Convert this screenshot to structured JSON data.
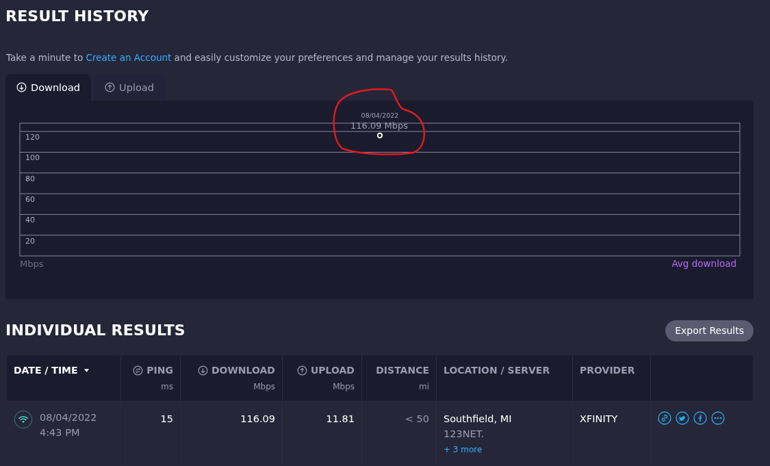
{
  "history": {
    "title": "RESULT HISTORY",
    "intro": {
      "before": "Take a minute to ",
      "link": "Create an Account",
      "after": " and easily customize your preferences and manage your results history."
    },
    "tabs": [
      {
        "label": "Download",
        "kind": "download",
        "selected": true
      },
      {
        "label": "Upload",
        "kind": "upload",
        "selected": false
      }
    ],
    "tooltip_value": "116.09 Mbps",
    "unit_label": "Mbps",
    "chart_data": {
      "type": "line",
      "categories": [
        "08/04/2022"
      ],
      "series": [
        {
          "name": "Avg download",
          "color": "#ffffff",
          "marker": true,
          "values": [
            116.09
          ]
        }
      ],
      "ylim": [
        0,
        128
      ],
      "yticks": [
        20,
        40,
        60,
        80,
        100,
        120
      ],
      "grid": true
    }
  },
  "results": {
    "title": "INDIVIDUAL RESULTS",
    "export_button": "Export Results",
    "columns": [
      {
        "label": "DATE / TIME",
        "kind": "text",
        "sorted": true
      },
      {
        "label": "PING",
        "unit": "ms",
        "kind": "ping",
        "sorted": false
      },
      {
        "label": "DOWNLOAD",
        "unit": "Mbps",
        "kind": "download",
        "sorted": false
      },
      {
        "label": "UPLOAD",
        "unit": "Mbps",
        "kind": "upload",
        "sorted": false
      },
      {
        "label": "DISTANCE",
        "unit": "mi",
        "kind": "text",
        "sorted": false
      },
      {
        "label": "LOCATION / SERVER",
        "kind": "text",
        "sorted": false
      },
      {
        "label": "PROVIDER",
        "kind": "text",
        "sorted": false
      }
    ],
    "rows": [
      {
        "date": "08/04/2022",
        "time": "4:43 PM",
        "ping": "15",
        "download": "116.09",
        "upload": "11.81",
        "distance": "< 50",
        "location": "Southfield, MI",
        "server": "123NET.",
        "more": "+ 3 more",
        "provider": "XFINITY"
      }
    ]
  }
}
